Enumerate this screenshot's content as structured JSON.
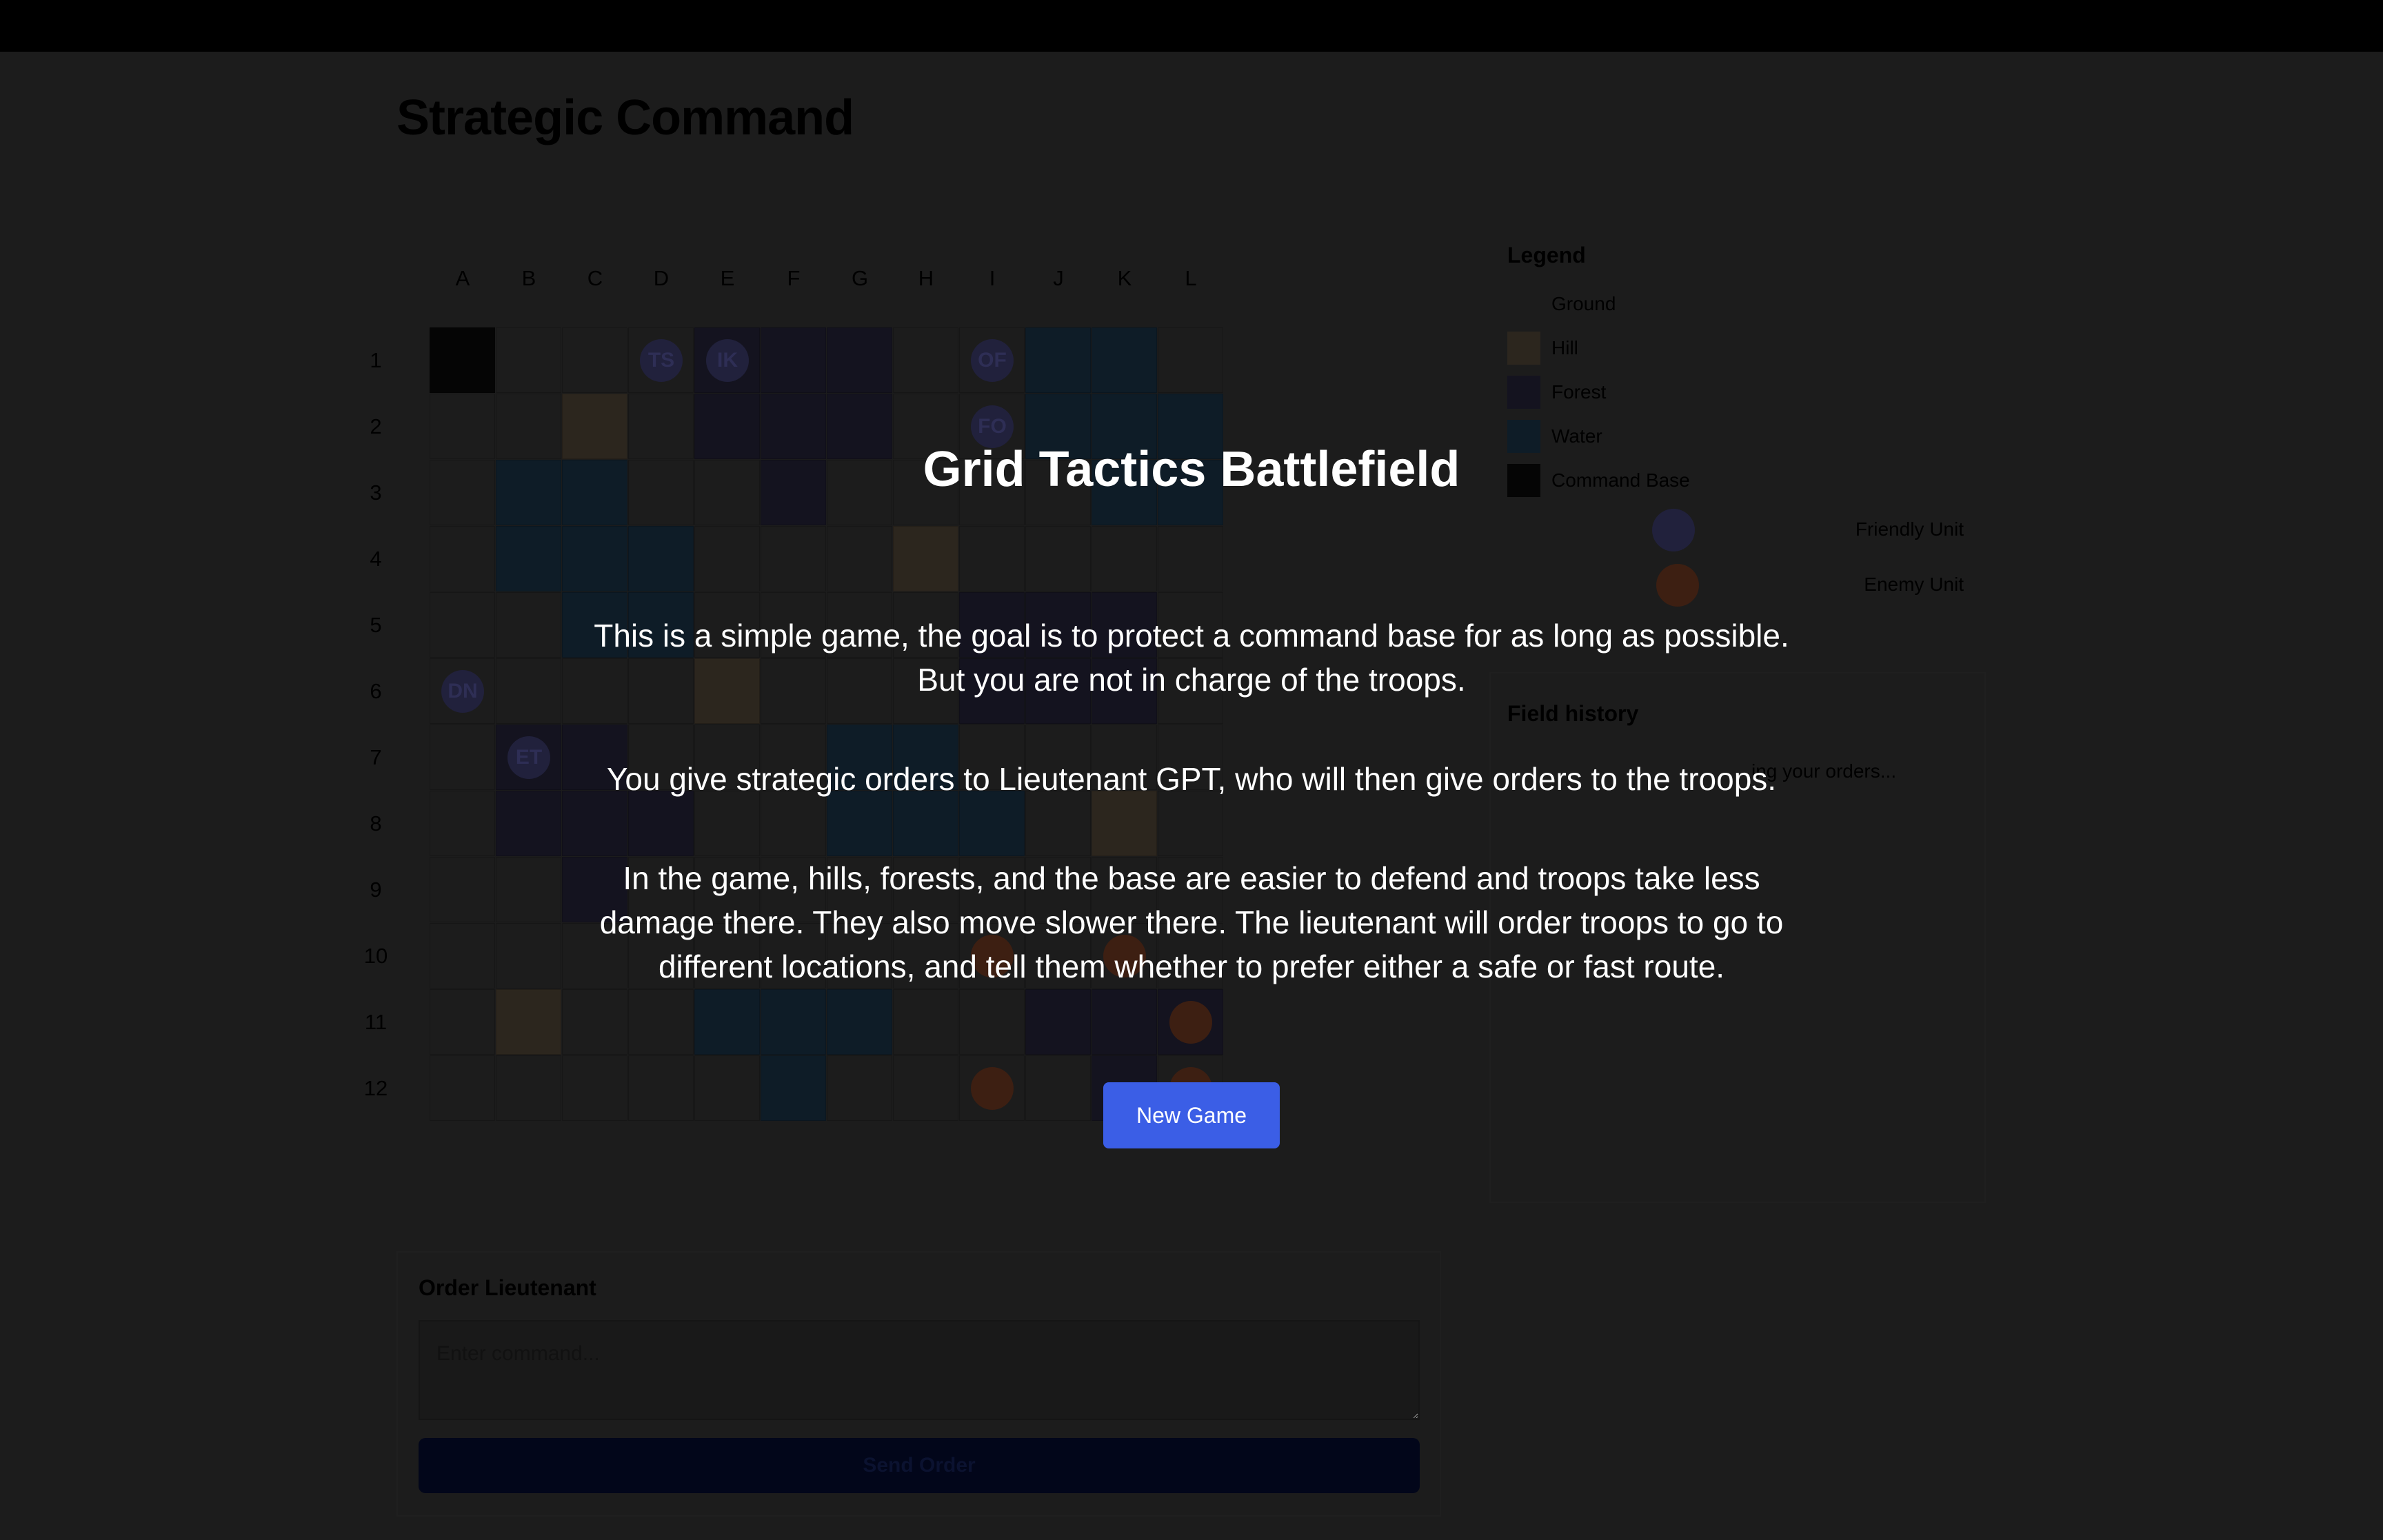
{
  "page": {
    "title": "Strategic Command"
  },
  "grid": {
    "columns": [
      "A",
      "B",
      "C",
      "D",
      "E",
      "F",
      "G",
      "H",
      "I",
      "J",
      "K",
      "L"
    ],
    "rows": [
      "1",
      "2",
      "3",
      "4",
      "5",
      "6",
      "7",
      "8",
      "9",
      "10",
      "11",
      "12"
    ],
    "terrain": {
      "base": [
        "A1"
      ],
      "hill": [
        "C2",
        "H4",
        "E6",
        "K8",
        "B11"
      ],
      "forest": [
        "E1",
        "F1",
        "G1",
        "E2",
        "F2",
        "G2",
        "F3",
        "I5",
        "J5",
        "K5",
        "I6",
        "J6",
        "K6",
        "B7",
        "C7",
        "B8",
        "C8",
        "D8",
        "C9",
        "J11",
        "K11",
        "L11",
        "K12"
      ],
      "water": [
        "J1",
        "K1",
        "J2",
        "K2",
        "L2",
        "K3",
        "L3",
        "B3",
        "C3",
        "B4",
        "C4",
        "D4",
        "C5",
        "D5",
        "G7",
        "H7",
        "G8",
        "H8",
        "I8",
        "E11",
        "F11",
        "G11",
        "F12"
      ]
    },
    "units": [
      {
        "label": "TS",
        "cell": "D1",
        "side": "friendly"
      },
      {
        "label": "IK",
        "cell": "E1",
        "side": "friendly"
      },
      {
        "label": "OF",
        "cell": "I1",
        "side": "friendly"
      },
      {
        "label": "FO",
        "cell": "I2",
        "side": "friendly"
      },
      {
        "label": "DN",
        "cell": "A6",
        "side": "friendly"
      },
      {
        "label": "ET",
        "cell": "B7",
        "side": "friendly"
      },
      {
        "label": "",
        "cell": "I10",
        "side": "enemy"
      },
      {
        "label": "",
        "cell": "K10",
        "side": "enemy"
      },
      {
        "label": "",
        "cell": "L11",
        "side": "enemy"
      },
      {
        "label": "",
        "cell": "I12",
        "side": "enemy"
      },
      {
        "label": "",
        "cell": "L12",
        "side": "enemy"
      }
    ]
  },
  "legend": {
    "heading": "Legend",
    "items": [
      {
        "label": "Ground",
        "color": "#1c1c1c"
      },
      {
        "label": "Hill",
        "color": "#2c261e"
      },
      {
        "label": "Forest",
        "color": "#14131f"
      },
      {
        "label": "Water",
        "color": "#0e1c27"
      },
      {
        "label": "Command Base",
        "color": "#050505"
      }
    ],
    "friendly_label": "Friendly Unit",
    "enemy_label": "Enemy Unit"
  },
  "history": {
    "heading": "Field history",
    "status_text": "ing your orders..."
  },
  "order": {
    "heading": "Order Lieutenant",
    "placeholder": "Enter command...",
    "send_label": "Send Order"
  },
  "modal": {
    "title": "Grid Tactics Battlefield",
    "para1_line1": "This is a simple game, the goal is to protect a command base for as long as possible.",
    "para1_line2": "But you are not in charge of the troops.",
    "para2": "You give strategic orders to Lieutenant GPT, who will then give orders to the troops.",
    "para3_line1": "In the game, hills, forests, and the base are easier to defend and troops take less",
    "para3_line2": "damage there. They also move slower there. The lieutenant will order troops to go to",
    "para3_line3": "different locations, and tell them whether to prefer either a safe or fast route.",
    "button_label": "New Game"
  }
}
